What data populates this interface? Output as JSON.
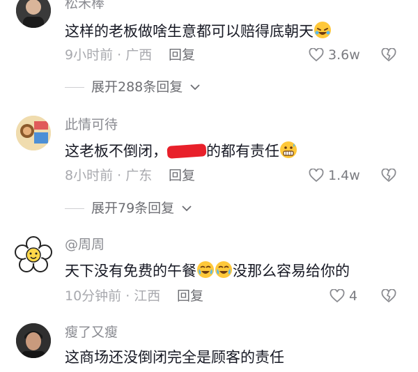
{
  "comments": [
    {
      "username": "松禾棒",
      "text": "这样的老板做啥生意都可以赔得底朝天",
      "text_emoji": "rofl-emoji",
      "time": "9小时前 · 广西",
      "reply": "回复",
      "likes": "3.6w",
      "expand": "展开288条回复"
    },
    {
      "username": "此情可待",
      "text_a": "这老板不倒闭，",
      "text_b": "的都有责任",
      "text_emoji": "grimace-sweat-emoji",
      "time": "8小时前 · 广东",
      "reply": "回复",
      "likes": "1.4w",
      "expand": "展开79条回复"
    },
    {
      "username": "@周周",
      "text_a": "天下没有免费的午餐",
      "text_b": "没那么容易给你的",
      "text_emoji": "crying-laughing-emoji",
      "time": "10分钟前 · 江西",
      "reply": "回复",
      "likes": "4"
    },
    {
      "username": "瘦了又瘦",
      "text": "这商场还没倒闭完全是顾客的责任"
    }
  ],
  "icons": {
    "like": "heart-outline-icon",
    "dislike": "broken-heart-icon",
    "expand": "chevron-down-icon"
  },
  "colors": {
    "redaction": "#e8202a",
    "text": "#161823",
    "meta": "#a8a9ae"
  }
}
